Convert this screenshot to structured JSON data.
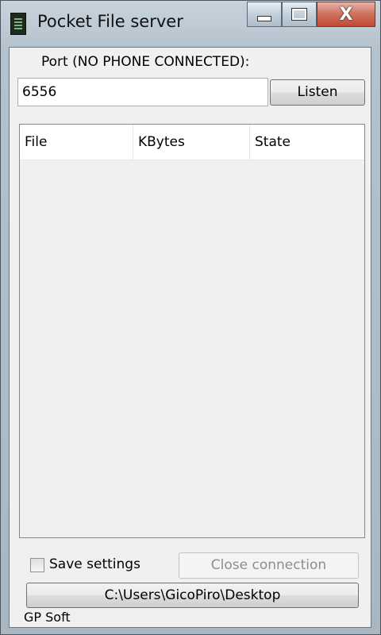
{
  "window": {
    "title": "Pocket File server"
  },
  "caption_buttons": {
    "close_glyph": "X"
  },
  "port": {
    "label": "Port (NO PHONE CONNECTED):",
    "value": "6556"
  },
  "listen_button": {
    "label": "Listen"
  },
  "file_list": {
    "columns": [
      "File",
      "KBytes",
      "State"
    ],
    "rows": []
  },
  "save_settings": {
    "label": "Save settings",
    "checked": false
  },
  "close_connection": {
    "label": "Close connection",
    "enabled": false
  },
  "path_button": {
    "label": "C:\\Users\\GicoPiro\\Desktop"
  },
  "footer": {
    "text": "GP Soft"
  }
}
